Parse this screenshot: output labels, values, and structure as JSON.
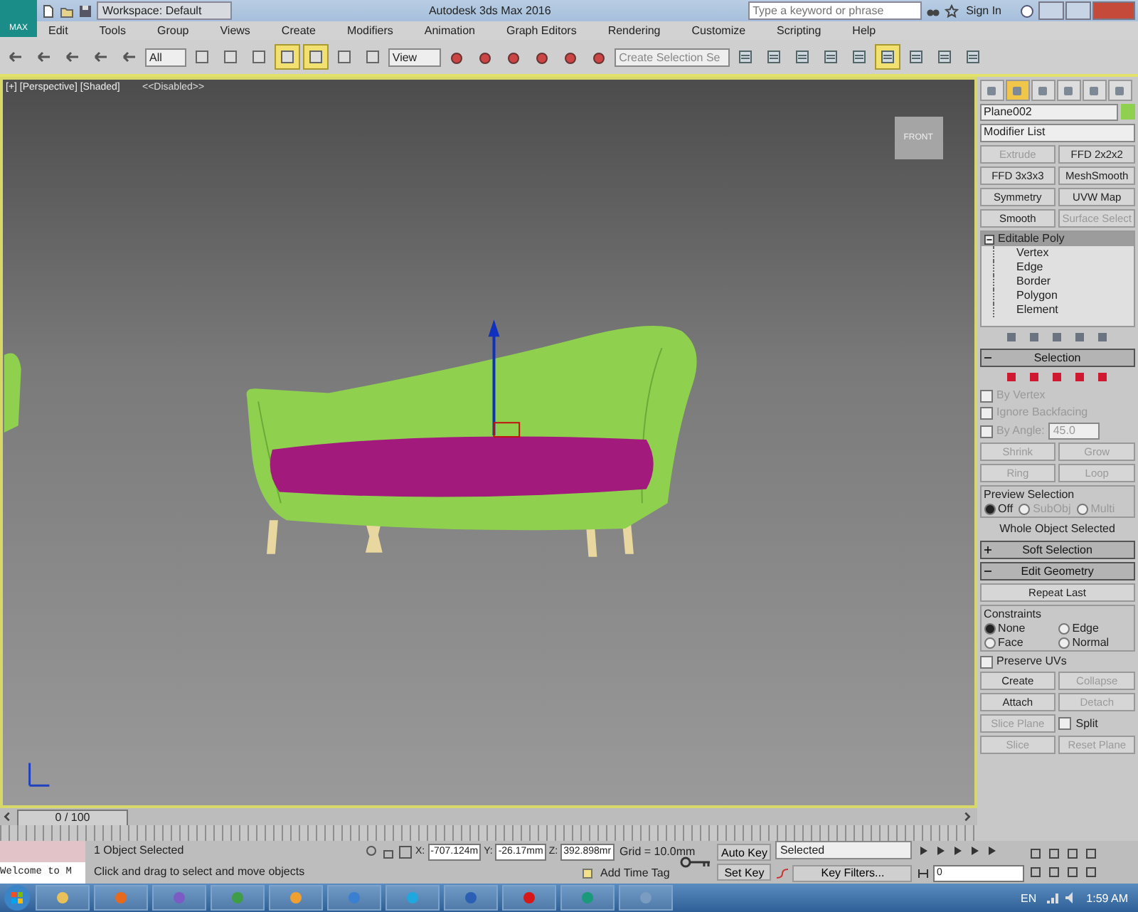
{
  "title_bar": {
    "app_button": "MAX",
    "workspace": "Workspace: Default",
    "title": "Autodesk 3ds Max 2016",
    "search_placeholder": "Type a keyword or phrase",
    "sign_in": "Sign In"
  },
  "menu": [
    "Edit",
    "Tools",
    "Group",
    "Views",
    "Create",
    "Modifiers",
    "Animation",
    "Graph Editors",
    "Rendering",
    "Customize",
    "Scripting",
    "Help"
  ],
  "toolbar": {
    "selection_filter": "All",
    "ref_coord": "View",
    "named_selection": "Create Selection Se",
    "buttons": [
      {
        "selected": false
      },
      {
        "selected": false
      },
      {
        "selected": false
      },
      {
        "selected": false
      },
      {
        "selected": false
      },
      {
        "selected": false
      },
      {
        "selected": false
      },
      {
        "selected": false
      },
      {
        "selected": true
      },
      {
        "selected": true
      },
      {
        "selected": false
      },
      {
        "selected": false
      },
      {
        "selected": false
      },
      {
        "selected": false
      },
      {
        "selected": false
      },
      {
        "selected": false
      },
      {
        "selected": false
      },
      {
        "selected": false
      },
      {
        "selected": false
      },
      {
        "selected": false
      },
      {
        "selected": false
      },
      {
        "selected": false
      },
      {
        "selected": false
      },
      {
        "selected": true
      },
      {
        "selected": false
      },
      {
        "selected": false
      },
      {
        "selected": false
      }
    ]
  },
  "viewport": {
    "label": "[+] [Perspective] [Shaded]",
    "disabled_label": "<<Disabled>>",
    "viewcube": "FRONT"
  },
  "command_panel": {
    "tabs": [
      {
        "selected": false
      },
      {
        "selected": true
      },
      {
        "selected": false
      },
      {
        "selected": false
      },
      {
        "selected": false
      },
      {
        "selected": false
      }
    ],
    "object": {
      "name": "Plane002",
      "color": "#8fd14f"
    },
    "modifier_list": "Modifier List",
    "modifier_buttons": [
      {
        "label": "Extrude",
        "disabled": true
      },
      {
        "label": "FFD 2x2x2",
        "disabled": false
      },
      {
        "label": "FFD 3x3x3",
        "disabled": false
      },
      {
        "label": "MeshSmooth",
        "disabled": false
      },
      {
        "label": "Symmetry",
        "disabled": false
      },
      {
        "label": "UVW Map",
        "disabled": false
      },
      {
        "label": "Smooth",
        "disabled": false
      },
      {
        "label": "Surface Select",
        "disabled": true
      }
    ],
    "stack": {
      "label": "Editable Poly",
      "expanded": true,
      "children": [
        {
          "label": "Vertex"
        },
        {
          "label": "Edge"
        },
        {
          "label": "Border"
        },
        {
          "label": "Polygon"
        },
        {
          "label": "Element"
        }
      ]
    },
    "selection": {
      "title": "Selection",
      "expanded": true,
      "checks": [
        {
          "label": "By Vertex",
          "checked": false
        },
        {
          "label": "Ignore Backfacing",
          "checked": false
        },
        {
          "label": "By Angle:",
          "checked": false
        }
      ],
      "angle": "45.0",
      "buttons": [
        "Shrink",
        "Grow",
        "Ring",
        "Loop"
      ],
      "preview_title": "Preview Selection",
      "preview_options": [
        {
          "label": "Off",
          "selected": true
        },
        {
          "label": "SubObj",
          "selected": false
        },
        {
          "label": "Multi",
          "selected": false
        }
      ],
      "status": "Whole Object Selected"
    },
    "soft_selection": {
      "title": "Soft Selection",
      "expanded": false
    },
    "edit_geometry": {
      "title": "Edit Geometry",
      "expanded": true,
      "repeat_last": "Repeat Last",
      "constraints_title": "Constraints",
      "constraints": [
        {
          "label": "None",
          "selected": true
        },
        {
          "label": "Edge",
          "selected": false
        },
        {
          "label": "Face",
          "selected": false
        },
        {
          "label": "Normal",
          "selected": false
        }
      ],
      "preserve_uvs": {
        "label": "Preserve UVs",
        "checked": false
      },
      "buttons": [
        {
          "label": "Create",
          "disabled": false
        },
        {
          "label": "Collapse",
          "disabled": true
        },
        {
          "label": "Attach",
          "disabled": false
        },
        {
          "label": "Detach",
          "disabled": true
        },
        {
          "label": "Slice Plane",
          "disabled": true
        },
        {
          "label": "Split",
          "disabled": false,
          "kind": "checkbox",
          "checked": false
        },
        {
          "label": "Slice",
          "disabled": true
        },
        {
          "label": "Reset Plane",
          "disabled": true
        }
      ]
    }
  },
  "time_slider": {
    "label": "0 / 100"
  },
  "status": {
    "listener": "Welcome to M",
    "selected_info": "1 Object Selected",
    "prompt": "Click and drag to select and move objects",
    "x_label": "X:",
    "x": "-707.124m",
    "y_label": "Y:",
    "y": "-26.17mm",
    "z_label": "Z:",
    "z": "392.898mr",
    "grid": "Grid = 10.0mm",
    "add_time_tag": "Add Time Tag",
    "auto_key": "Auto Key",
    "set_key": "Set Key",
    "key_mode": "Selected",
    "key_filters": "Key Filters...",
    "frame": "0"
  },
  "taskbar": {
    "apps": [
      {
        "color": "#e8c15a"
      },
      {
        "color": "#e56a1c"
      },
      {
        "color": "#7b5cc4"
      },
      {
        "color": "#3f9c47"
      },
      {
        "color": "#f0a030"
      },
      {
        "color": "#3a7fd0"
      },
      {
        "color": "#1fa8e0"
      },
      {
        "color": "#2b5fb4"
      },
      {
        "color": "#d81818"
      },
      {
        "color": "#1a9a7a"
      },
      {
        "color": "#7a9cc0"
      }
    ],
    "language": "EN",
    "clock": "1:59 AM"
  }
}
